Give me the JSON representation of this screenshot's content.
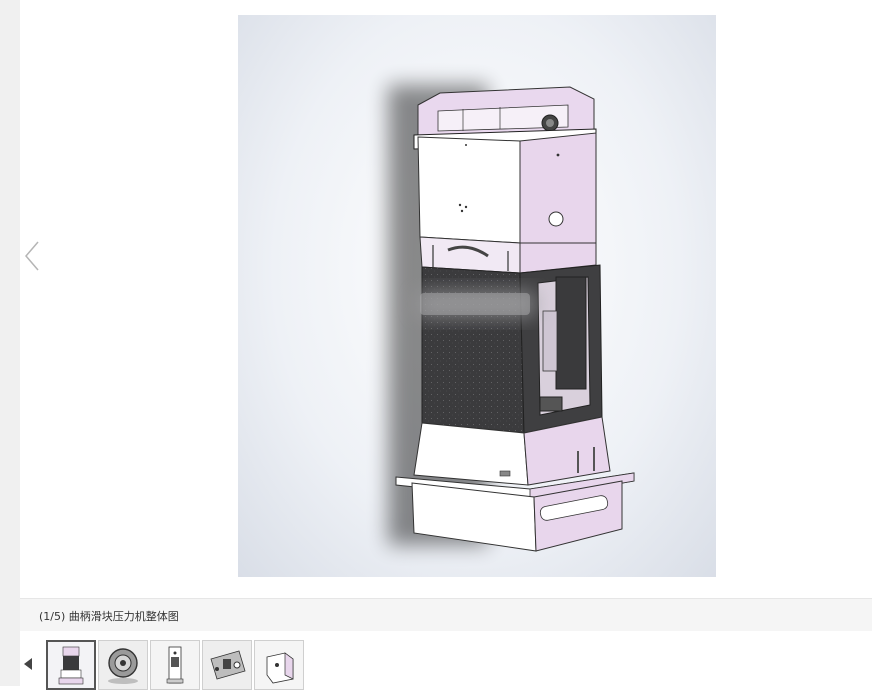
{
  "viewer": {
    "image_alt": "曲柄滑块压力机整体图"
  },
  "caption": {
    "text": "(1/5) 曲柄滑块压力机整体图"
  },
  "icons": {
    "prev": "chevron-left-icon",
    "thumb_prev": "triangle-left-icon"
  },
  "thumbnails": [
    {
      "name": "thumb-1",
      "active": true
    },
    {
      "name": "thumb-2",
      "active": false
    },
    {
      "name": "thumb-3",
      "active": false
    },
    {
      "name": "thumb-4",
      "active": false
    },
    {
      "name": "thumb-5",
      "active": false
    }
  ],
  "colors": {
    "accent_pink": "#e8d6ec",
    "dark_body": "#3a3a3c"
  }
}
